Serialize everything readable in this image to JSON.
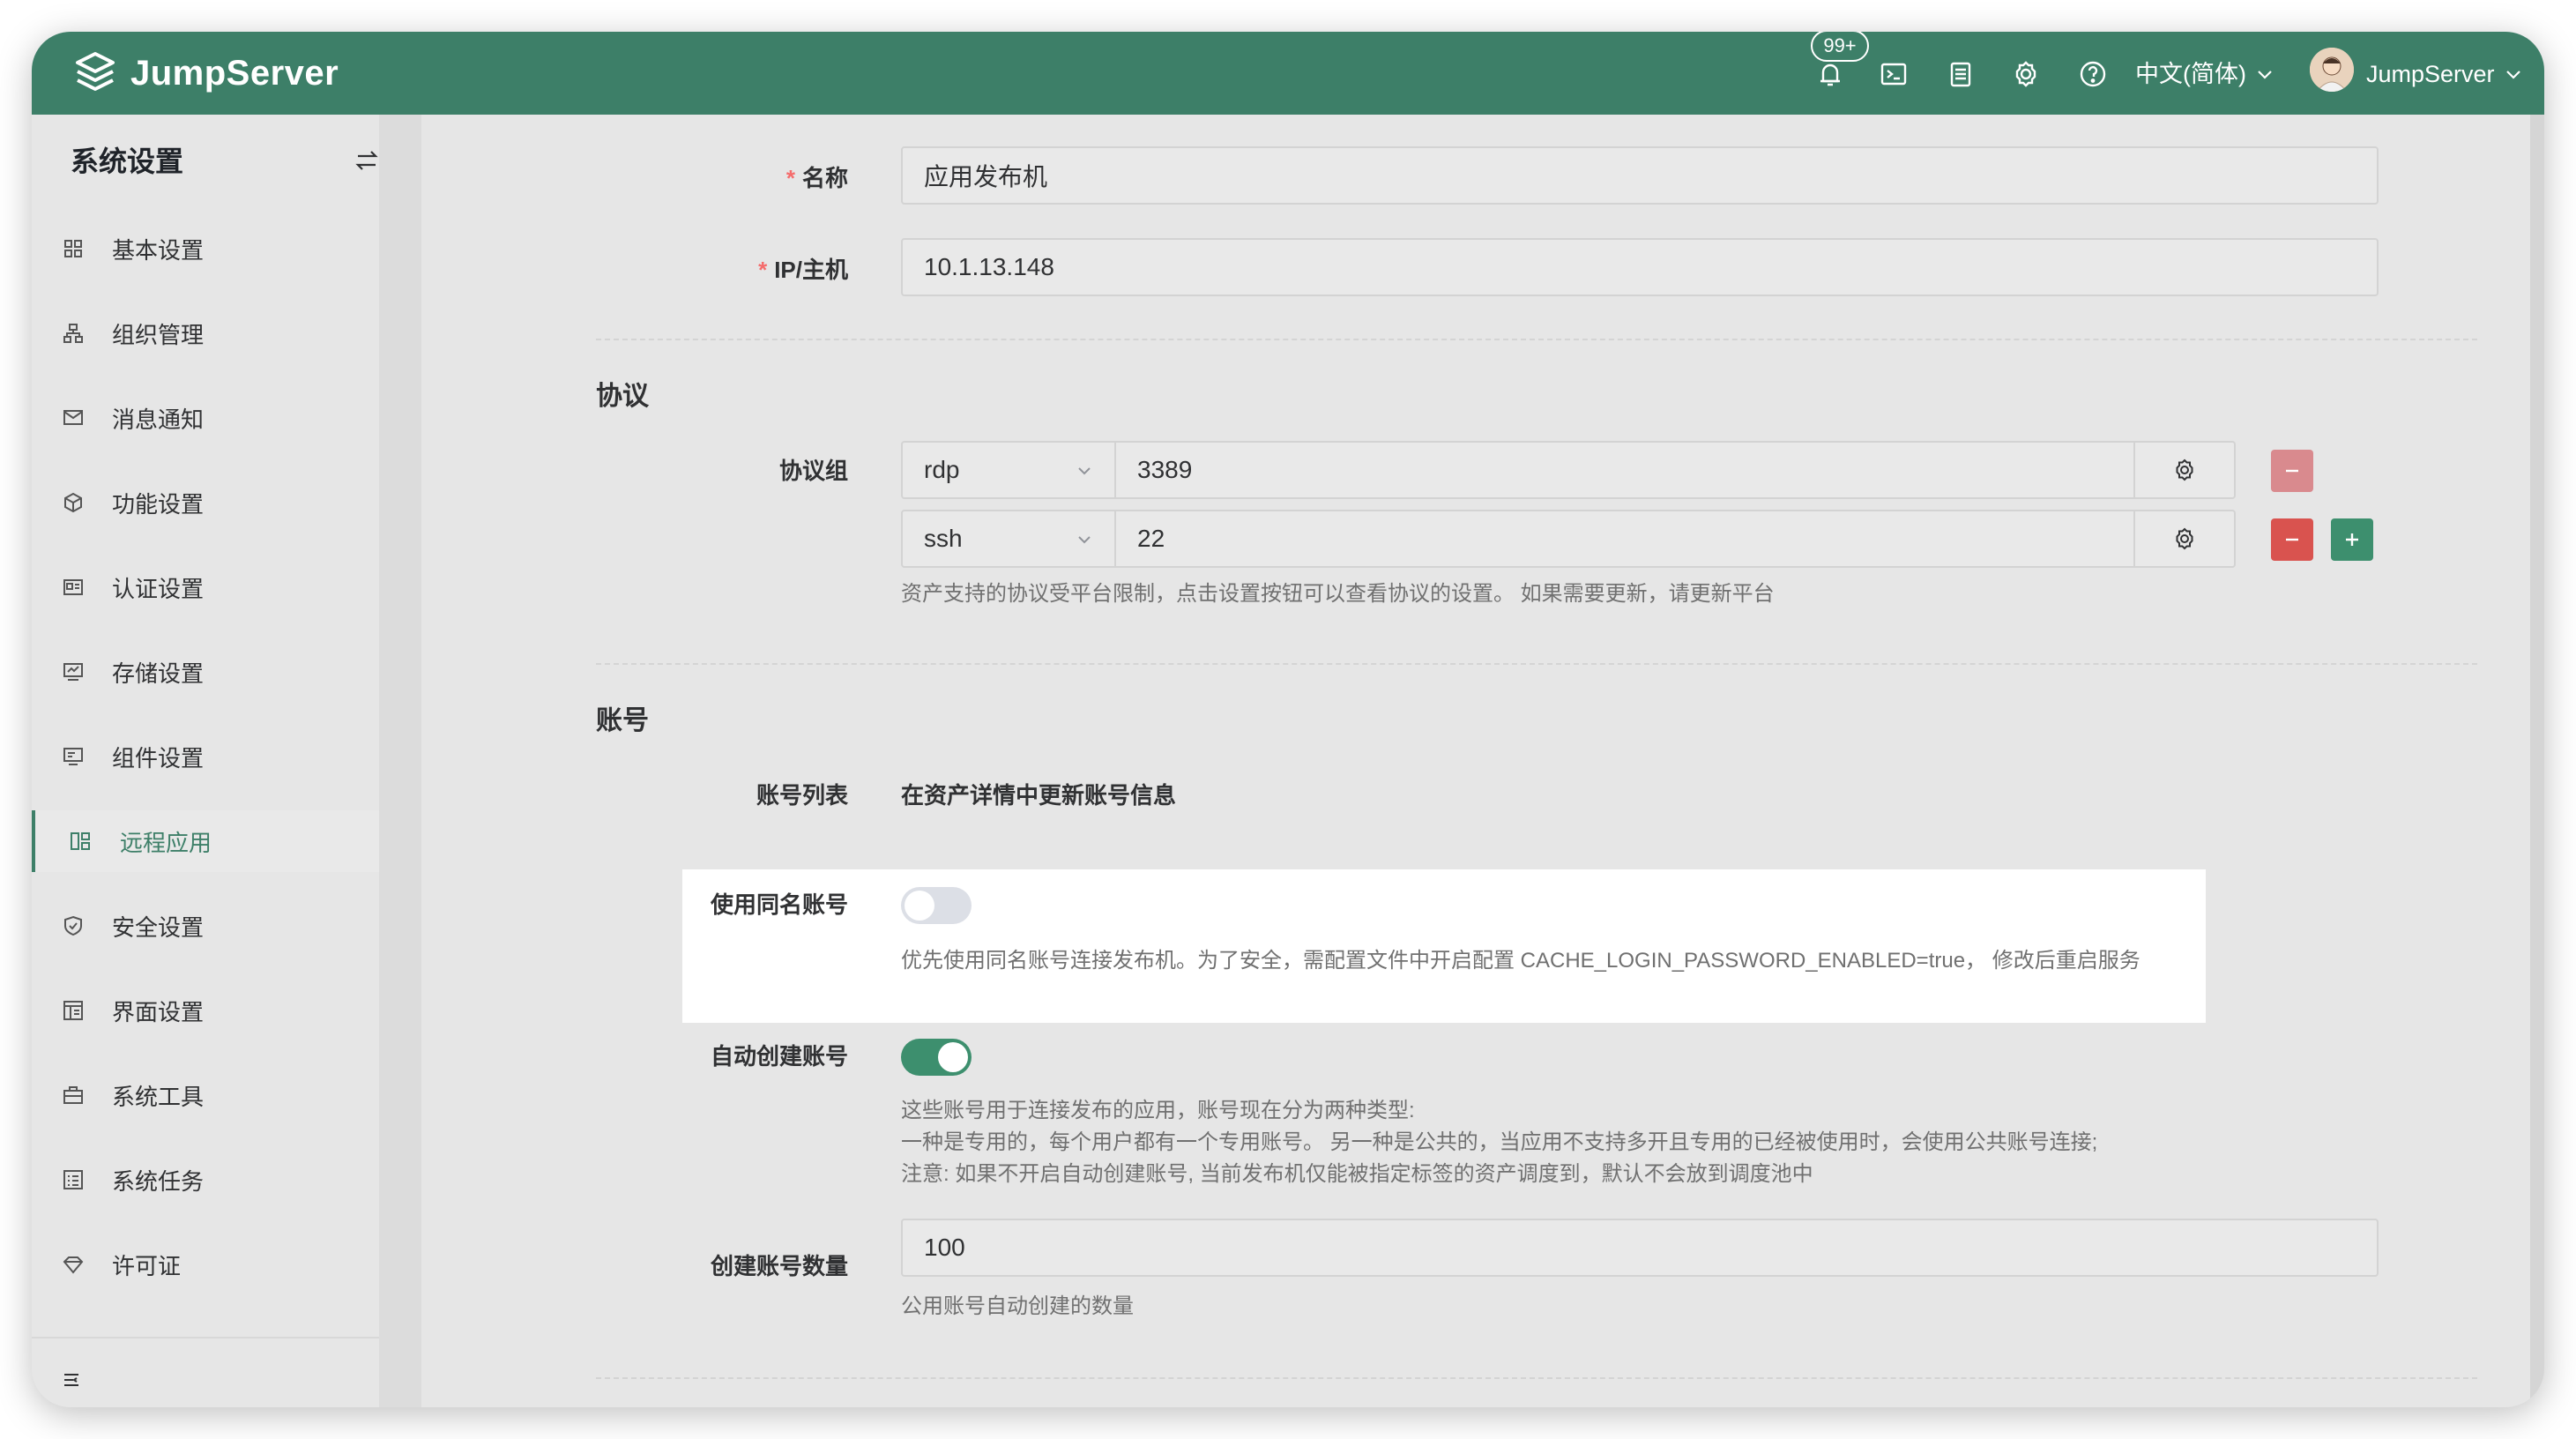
{
  "header": {
    "brand": "JumpServer",
    "notifications_badge": "99+",
    "language": "中文(简体)",
    "username": "JumpServer",
    "icons": [
      "bell-icon",
      "terminal-icon",
      "notes-icon",
      "gear-icon",
      "help-icon"
    ]
  },
  "sidebar": {
    "title": "系统设置",
    "items": [
      {
        "label": "基本设置",
        "icon": "grid-icon"
      },
      {
        "label": "组织管理",
        "icon": "org-icon"
      },
      {
        "label": "消息通知",
        "icon": "message-icon"
      },
      {
        "label": "功能设置",
        "icon": "cube-icon"
      },
      {
        "label": "认证设置",
        "icon": "id-card-icon"
      },
      {
        "label": "存储设置",
        "icon": "storage-icon"
      },
      {
        "label": "组件设置",
        "icon": "monitor-icon"
      },
      {
        "label": "远程应用",
        "icon": "apps-icon",
        "active": true
      },
      {
        "label": "安全设置",
        "icon": "shield-icon"
      },
      {
        "label": "界面设置",
        "icon": "layout-icon"
      },
      {
        "label": "系统工具",
        "icon": "toolbox-icon"
      },
      {
        "label": "系统任务",
        "icon": "task-icon"
      },
      {
        "label": "许可证",
        "icon": "diamond-icon"
      }
    ]
  },
  "form": {
    "name_label": "名称",
    "name_value": "应用发布机",
    "ip_label": "IP/主机",
    "ip_value": "10.1.13.148",
    "protocol_section": "协议",
    "protocol_group_label": "协议组",
    "protocols": [
      {
        "name": "rdp",
        "port": "3389"
      },
      {
        "name": "ssh",
        "port": "22"
      }
    ],
    "protocol_help": "资产支持的协议受平台限制，点击设置按钮可以查看协议的设置。 如果需要更新，请更新平台",
    "account_section": "账号",
    "account_list_label": "账号列表",
    "account_list_value": "在资产详情中更新账号信息",
    "same_name_label": "使用同名账号",
    "same_name_enabled": false,
    "same_name_help": "优先使用同名账号连接发布机。为了安全，需配置文件中开启配置 CACHE_LOGIN_PASSWORD_ENABLED=true， 修改后重启服务",
    "auto_create_label": "自动创建账号",
    "auto_create_enabled": true,
    "auto_create_help": [
      "这些账号用于连接发布的应用，账号现在分为两种类型:",
      "一种是专用的，每个用户都有一个专用账号。 另一种是公共的，当应用不支持多开且专用的已经被使用时，会使用公共账号连接;",
      "注意: 如果不开启自动创建账号, 当前发布机仅能被指定标签的资产调度到，默认不会放到调度池中"
    ],
    "account_count_label": "创建账号数量",
    "account_count_value": "100",
    "account_count_help": "公用账号自动创建的数量"
  },
  "colors": {
    "brand": "#3d7f68",
    "danger": "#d9534f",
    "danger_disabled": "#d98a8e",
    "required": "#f56c6c"
  }
}
